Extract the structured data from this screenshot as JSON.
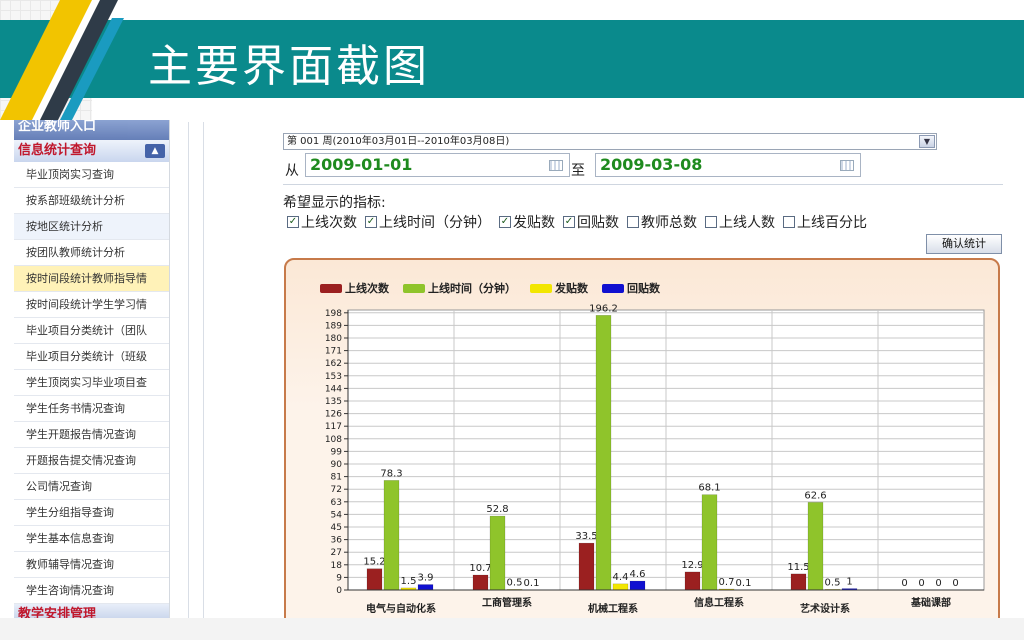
{
  "slide": {
    "title": "主要界面截图"
  },
  "sidebar": {
    "top_header": "企业教师入口",
    "active_header": "信息统计查询",
    "bottom_header": "教学安排管理",
    "items": [
      "毕业顶岗实习查询",
      "按系部班级统计分析",
      "按地区统计分析",
      "按团队教师统计分析",
      "按时间段统计教师指导情",
      "按时间段统计学生学习情",
      "毕业项目分类统计（团队",
      "毕业项目分类统计（班级",
      "学生顶岗实习毕业项目查",
      "学生任务书情况查询",
      "学生开题报告情况查询",
      "开题报告提交情况查询",
      "公司情况查询",
      "学生分组指导查询",
      "学生基本信息查询",
      "教师辅导情况查询",
      "学生咨询情况查询"
    ]
  },
  "form": {
    "week_select": "第 001 周(2010年03月01日--2010年03月08日)",
    "from_label": "从",
    "to_label": "至",
    "date_from": "2009-01-01",
    "date_to": "2009-03-08",
    "indicators_label": "希望显示的指标:",
    "checks": [
      {
        "label": "上线次数",
        "checked": true
      },
      {
        "label": "上线时间（分钟）",
        "checked": true
      },
      {
        "label": "发贴数",
        "checked": true
      },
      {
        "label": "回贴数",
        "checked": true
      },
      {
        "label": "教师总数",
        "checked": false
      },
      {
        "label": "上线人数",
        "checked": false
      },
      {
        "label": "上线百分比",
        "checked": false
      }
    ],
    "confirm_button": "确认统计"
  },
  "chart_data": {
    "type": "bar",
    "categories": [
      "电气与自动化系",
      "工商管理系",
      "机械工程系",
      "信息工程系",
      "艺术设计系",
      "基础课部"
    ],
    "series": [
      {
        "name": "上线次数",
        "color": "#9b2020",
        "values": [
          15.2,
          10.7,
          33.5,
          12.9,
          11.5,
          0
        ],
        "labels": [
          "15.2",
          "10.7",
          "33.5",
          "12.9",
          "11.5",
          "0"
        ]
      },
      {
        "name": "上线时间（分钟）",
        "color": "#8fc42b",
        "values": [
          78.3,
          52.8,
          196.2,
          68.1,
          62.6,
          0
        ],
        "labels": [
          "78.3",
          "52.8",
          "196.2",
          "68.1",
          "62.6",
          "0"
        ]
      },
      {
        "name": "发贴数",
        "color": "#f2e600",
        "values": [
          1.5,
          0.5,
          4.4,
          0.7,
          0.5,
          0
        ],
        "labels": [
          "1.5",
          "0.5",
          "4.4",
          "0.7",
          "0.5",
          "0"
        ]
      },
      {
        "name": "回贴数",
        "color": "#1010d0",
        "values": [
          3.9,
          0.1,
          6.4,
          0.1,
          1,
          0
        ],
        "labels": [
          "3.9",
          "0.1",
          "4.6",
          "0.1",
          "1",
          "0"
        ]
      }
    ],
    "yticks": [
      0,
      9,
      18,
      27,
      36,
      45,
      54,
      63,
      72,
      81,
      90,
      99,
      108,
      117,
      126,
      135,
      144,
      153,
      162,
      171,
      180,
      189,
      198
    ],
    "ylim": [
      0,
      200
    ],
    "grid": true,
    "legend_position": "top-left"
  }
}
